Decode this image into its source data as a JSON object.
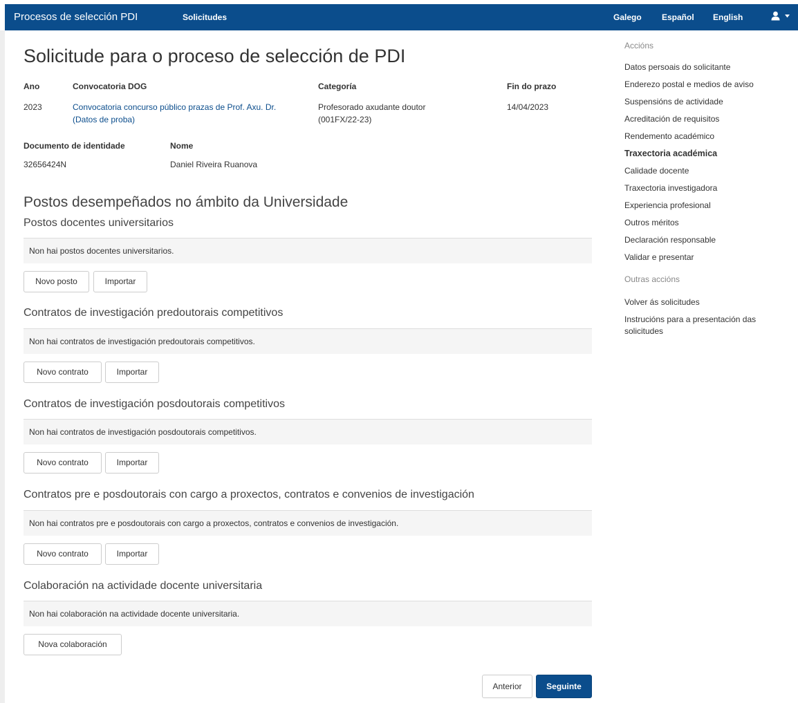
{
  "navbar": {
    "brand": "Procesos de selección PDI",
    "solicitudes": "Solicitudes",
    "languages": [
      "Galego",
      "Español",
      "English"
    ],
    "user_icon": "user-icon"
  },
  "page": {
    "title": "Solicitude para o proceso de selección de PDI",
    "ano_label": "Ano",
    "ano_value": "2023",
    "convocatoria_label": "Convocatoria DOG",
    "convocatoria_value": "Convocatoria concurso público prazas de Prof. Axu. Dr. (Datos de proba)",
    "categoria_label": "Categoría",
    "categoria_value": "Profesorado axudante doutor (001FX/22-23)",
    "fin_label": "Fin do prazo",
    "fin_value": "14/04/2023",
    "doc_label": "Documento de identidade",
    "doc_value": "32656424N",
    "nome_label": "Nome",
    "nome_value": "Daniel Riveira Ruanova",
    "section_title": "Postos desempeñados no ámbito da Universidade"
  },
  "subsections": {
    "postos": {
      "title": "Postos docentes universitarios",
      "empty": "Non hai postos docentes universitarios.",
      "new_label": "Novo posto",
      "import_label": "Importar"
    },
    "predoc": {
      "title": "Contratos de investigación predoutorais competitivos",
      "empty": "Non hai contratos de investigación predoutorais competitivos.",
      "new_label": "Novo contrato",
      "import_label": "Importar"
    },
    "posdoc": {
      "title": "Contratos de investigación posdoutorais competitivos",
      "empty": "Non hai contratos de investigación posdoutorais competitivos.",
      "new_label": "Novo contrato",
      "import_label": "Importar"
    },
    "cargo": {
      "title": "Contratos pre e posdoutorais con cargo a proxectos, contratos e convenios de investigación",
      "empty": "Non hai contratos pre e posdoutorais con cargo a proxectos, contratos e convenios de investigación.",
      "new_label": "Novo contrato",
      "import_label": "Importar"
    },
    "colab": {
      "title": "Colaboración na actividade docente universitaria",
      "empty": "Non hai colaboración na actividade docente universitaria.",
      "new_label": "Nova colaboración"
    }
  },
  "footer": {
    "prev_label": "Anterior",
    "next_label": "Seguinte"
  },
  "sidebar": {
    "acciones_heading": "Accións",
    "items": [
      "Datos persoais do solicitante",
      "Enderezo postal e medios de aviso",
      "Suspensións de actividade",
      "Acreditación de requisitos",
      "Rendemento académico",
      "Traxectoria académica",
      "Calidade docente",
      "Traxectoria investigadora",
      "Experiencia profesional",
      "Outros méritos",
      "Declaración responsable",
      "Validar e presentar"
    ],
    "active_item": "Traxectoria académica",
    "outras_heading": "Outras accións",
    "other_items": [
      "Volver ás solicitudes",
      "Instrucións para a presentación das solicitudes"
    ]
  },
  "colors": {
    "navbar": "#0b4d8c",
    "primary_button": "#0b4d8c",
    "link": "#0b4d8c"
  }
}
